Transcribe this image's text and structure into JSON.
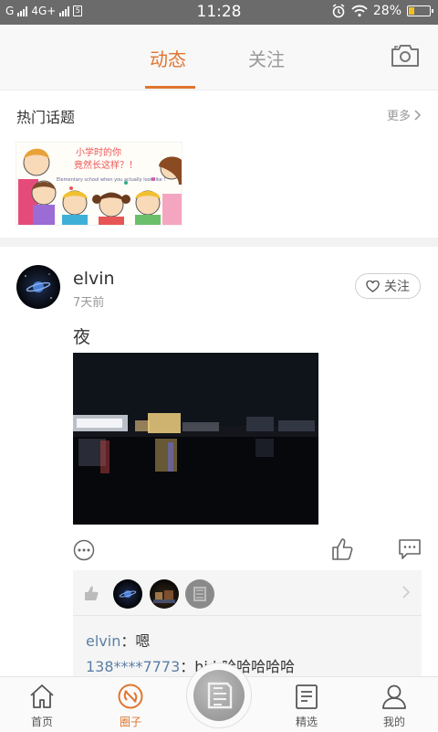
{
  "status_bar": {
    "carrier": "G",
    "network": "4G+",
    "time": "11:28",
    "battery_percent": "28%",
    "battery_level": 0.28,
    "icons": [
      "signal-icon",
      "sim-icon",
      "alarm-icon",
      "wifi-icon",
      "battery-icon"
    ]
  },
  "header": {
    "tabs": [
      {
        "label": "动态",
        "active": true
      },
      {
        "label": "关注",
        "active": false
      }
    ],
    "camera_icon": "camera-icon",
    "accent_color": "#e0752f"
  },
  "hot_topics": {
    "title": "热门话题",
    "more_label": "更多",
    "banner": {
      "line1": "小学时的你",
      "line2": "竟然长这样？！",
      "line3": "Elementary school when you actually look like !"
    }
  },
  "post": {
    "username": "elvin",
    "time_ago": "7天前",
    "follow_label": "关注",
    "text": "夜",
    "likes": {
      "liker_count": 3
    },
    "comments": [
      {
        "name": "elvin",
        "separator": "：",
        "text": "嗯"
      },
      {
        "name": "138****7773",
        "separator": "：",
        "text": "hi h哈哈哈哈哈"
      }
    ]
  },
  "tab_bar": {
    "items": [
      {
        "label": "首页",
        "icon": "home-icon"
      },
      {
        "label": "圈子",
        "icon": "circle-icon",
        "active": true
      },
      {
        "label": "精选",
        "icon": "document-icon"
      },
      {
        "label": "我的",
        "icon": "person-icon"
      }
    ],
    "center_icon": "logo-icon"
  }
}
